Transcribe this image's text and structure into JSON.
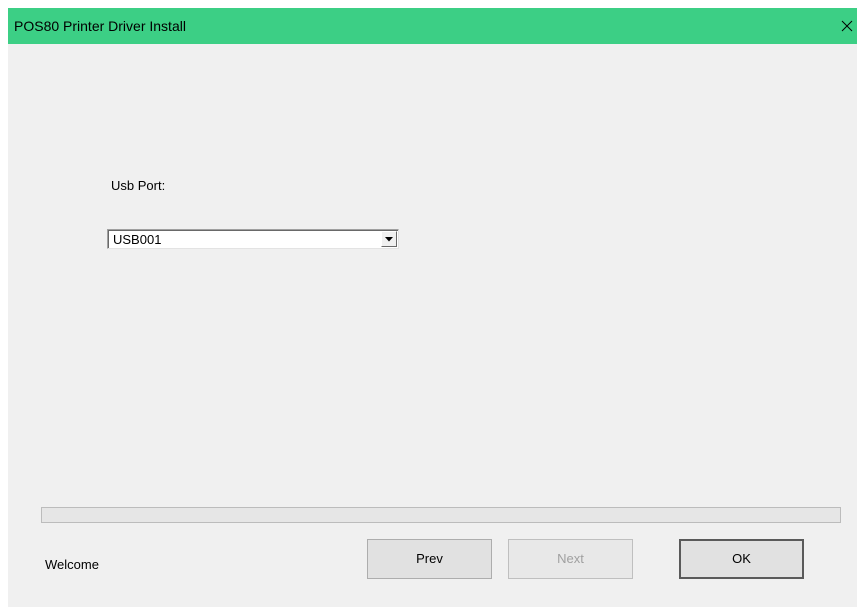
{
  "window": {
    "title": "POS80 Printer Driver Install",
    "titlebar_color": "#3ccf85"
  },
  "port": {
    "label": "Usb Port:",
    "selected": "USB001"
  },
  "progress": {
    "value": 0
  },
  "status": {
    "text": "Welcome"
  },
  "buttons": {
    "prev": "Prev",
    "next": "Next",
    "ok": "OK"
  },
  "icons": {
    "close": "close-icon",
    "dropdown": "chevron-down-icon"
  }
}
